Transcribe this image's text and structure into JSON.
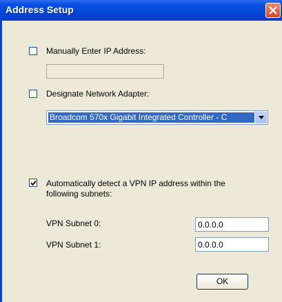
{
  "window": {
    "title": "Address Setup"
  },
  "manual_ip": {
    "label": "Manually Enter IP Address:",
    "checked": false,
    "value": ""
  },
  "adapter": {
    "label": "Designate Network Adapter:",
    "checked": false,
    "selected": "Broadcom 570x Gigabit Integrated Controller - C"
  },
  "auto_detect": {
    "label_line1": "Automatically detect a VPN IP address within the",
    "label_line2": "following subnets:",
    "checked": true
  },
  "subnets": [
    {
      "label": "VPN Subnet 0:",
      "value": "0.0.0.0"
    },
    {
      "label": "VPN Subnet 1:",
      "value": "0.0.0.0"
    }
  ],
  "buttons": {
    "ok": "OK"
  }
}
